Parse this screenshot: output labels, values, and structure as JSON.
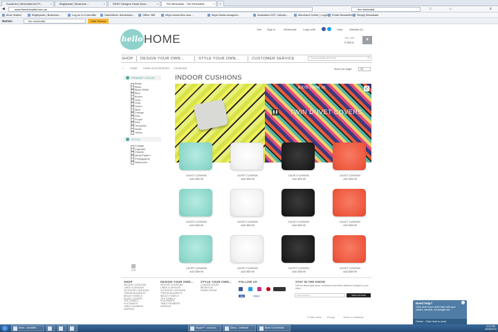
{
  "browser": {
    "tabs": [
      {
        "label": "Social Art | Minimalist Art Pr...",
        "active": false
      },
      {
        "label": "Brightpearl | Business ...",
        "active": false
      },
      {
        "label": "DENY Designs Home Acce...",
        "active": false
      },
      {
        "label": "The Minimalist - The Minimalist...",
        "active": true
      }
    ],
    "url": "www.theminimalist.com.au",
    "search_box": "the minimalist",
    "bookmarks": [
      "Most Visited",
      "Brightpearl | Business ...",
      "Log on to CommBiz",
      "SaaSoftest: Administra...",
      "Office 365",
      "https://www.flinx.com...",
      "https://www.escapeto...",
      "Australian GST Calcula...",
      "Merchant Center | Login",
      "Email Newsletter",
      "Simply Broadcast"
    ],
    "norton": {
      "brand": "Norton",
      "search_value": "the minimalist",
      "search_button": "Safe Search"
    }
  },
  "site": {
    "toplinks": [
      "Join",
      "Sign in",
      "Wholesale",
      "Login with",
      "Help",
      "Wishlist (0)"
    ],
    "cart": {
      "label": "Your cart",
      "items": "0 Items"
    },
    "logo": {
      "mark": "hello",
      "word": "HOME"
    },
    "nav": [
      "SHOP",
      "DESIGN YOUR OWN...",
      "STYLE YOUR OWN...",
      "CUSTOMER SERVICE"
    ],
    "search_placeholder": "Find products and more",
    "breadcrumb": [
      "HOME",
      "HOME ACCESSORIES",
      "CUSHIONS"
    ],
    "page_title": "INDOOR CUSHIONS",
    "sort": {
      "label": "Items per page:",
      "value": "24"
    }
  },
  "filters": {
    "color_title": "PRIMARY COLOR",
    "colors": [
      "Beige",
      "Black",
      "Black White",
      "Blue",
      "Brown",
      "Gold",
      "Gray",
      "Green",
      "Multi",
      "Orange",
      "Pink",
      "Purple",
      "Red",
      "Turquoise",
      "White",
      "Yellow"
    ],
    "style_title": "STYLE",
    "styles": [
      "Cottage",
      "Digimisin",
      "Graphic",
      "Mesh/Pattern",
      "Photography",
      "Watercolor"
    ]
  },
  "banner": {
    "small_caption": "KIDS TWIN XL",
    "caption": "TWIN DUVET COVERS"
  },
  "products": [
    {
      "name": "DUVET CUSHION",
      "price": "AUD $59.95",
      "color": "mint"
    },
    {
      "name": "DUVET CUSHION",
      "price": "AUD $59.95",
      "color": "white"
    },
    {
      "name": "DUVET CUSHION",
      "price": "AUD $59.95",
      "color": "black"
    },
    {
      "name": "DUVET CUSHION",
      "price": "AUD $59.95",
      "color": "red"
    },
    {
      "name": "DUVET CUSHION",
      "price": "AUD $59.95",
      "color": "mint"
    },
    {
      "name": "DUVET CUSHION",
      "price": "AUD $59.95",
      "color": "white"
    },
    {
      "name": "DUVET CUSHION",
      "price": "AUD $59.95",
      "color": "black"
    },
    {
      "name": "DUVET CUSHION",
      "price": "AUD $59.95",
      "color": "red"
    },
    {
      "name": "DUVET CUSHION",
      "price": "AUD $59.95",
      "color": "mint"
    },
    {
      "name": "DUVET CUSHION",
      "price": "AUD $59.95",
      "color": "white"
    },
    {
      "name": "DUVET CUSHION",
      "price": "AUD $59.95",
      "color": "black"
    },
    {
      "name": "DUVET CUSHION",
      "price": "AUD $59.95",
      "color": "red"
    }
  ],
  "top_button": "TOP",
  "footer": {
    "cols": [
      {
        "title": "SHOP",
        "items": [
          "INDOOR CUSHIONS",
          "LINEN CUSHIONS",
          "OUTDOOR CUSHIONS",
          "THROW BLANKETS",
          "BEACH TOWELS",
          "DUVET COVERS",
          "TEA TOWELS",
          "PLACEMATS",
          "TABLE RUNNERS",
          "NAPKINS"
        ]
      },
      {
        "title": "DESIGN YOUR OWN...",
        "items": [
          "INDOOR CUSHIONS",
          "LINEN CUSHIONS",
          "OUTDOOR CUSHIONS",
          "THROW BLANKETS",
          "BEACH TOWELS",
          "TEA TOWELS",
          "PLACEMATS",
          "TABLE RUNNERS",
          "NAPKINS"
        ]
      },
      {
        "title": "STYLE YOUR OWN...",
        "items": [
          "LOUNGE ROOM",
          "BEDROOM",
          "DINING ROOM"
        ]
      },
      {
        "title": "FOLLOW US",
        "items": []
      }
    ],
    "newsletter": {
      "title": "STAY IN THE KNOW",
      "desc": "Get the latest style news, collections and offers delivered straight to your inbox.",
      "placeholder": "Email Address",
      "button": "SIGN UP NOW"
    },
    "fb_like": "Like",
    "fb_share": "Share",
    "copyright": "© Hello Home",
    "bottom_links": [
      "Privacy",
      "Terms & Conditions"
    ]
  },
  "chat": {
    "title": "Need help?",
    "desc": "Click here if you need help with your orders, refunds, exchanges etc.",
    "bar": "Online - Click here to chat"
  },
  "taskbar": {
    "items": [
      "Inbox - socialBe...",
      "",
      "",
      "",
      "Skype™ - sa.ha.sl...",
      "Dinny - OneNote",
      "Book To OneNote"
    ],
    "time": "3:24 PM",
    "date": "26/09/2016"
  },
  "colors": {
    "accent": "#4aa5a0",
    "mint": "#8fd8cb",
    "red": "#ee5a40",
    "black": "#1f1f1f",
    "white": "#f2f2f2"
  }
}
